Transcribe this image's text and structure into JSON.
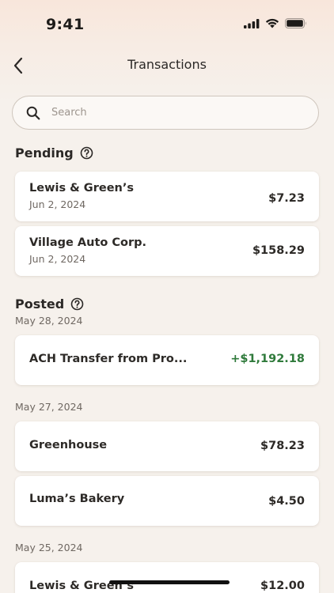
{
  "status_bar": {
    "time": "9:41"
  },
  "header": {
    "title": "Transactions"
  },
  "search": {
    "placeholder": "Search",
    "value": ""
  },
  "pending": {
    "heading": "Pending",
    "items": [
      {
        "name": "Lewis & Green’s",
        "date": "Jun 2, 2024",
        "amount": "$7.23"
      },
      {
        "name": "Village Auto Corp.",
        "date": "Jun 2, 2024",
        "amount": "$158.29"
      }
    ]
  },
  "posted": {
    "heading": "Posted",
    "groups": [
      {
        "date": "May 28, 2024",
        "items": [
          {
            "name": "ACH Transfer from Pro...",
            "amount": "+$1,192.18"
          }
        ]
      },
      {
        "date": "May 27, 2024",
        "items": [
          {
            "name": "Greenhouse",
            "amount": "$78.23"
          },
          {
            "name": "Luma’s Bakery",
            "amount": "$4.50"
          }
        ]
      },
      {
        "date": "May 25, 2024",
        "items": [
          {
            "name": "Lewis & Green’s",
            "amount": "$12.00"
          }
        ]
      }
    ]
  },
  "colors": {
    "background": "#f6f1ec",
    "credit": "#2f7a3b",
    "text": "#2d2a27",
    "muted": "#6f6862"
  }
}
